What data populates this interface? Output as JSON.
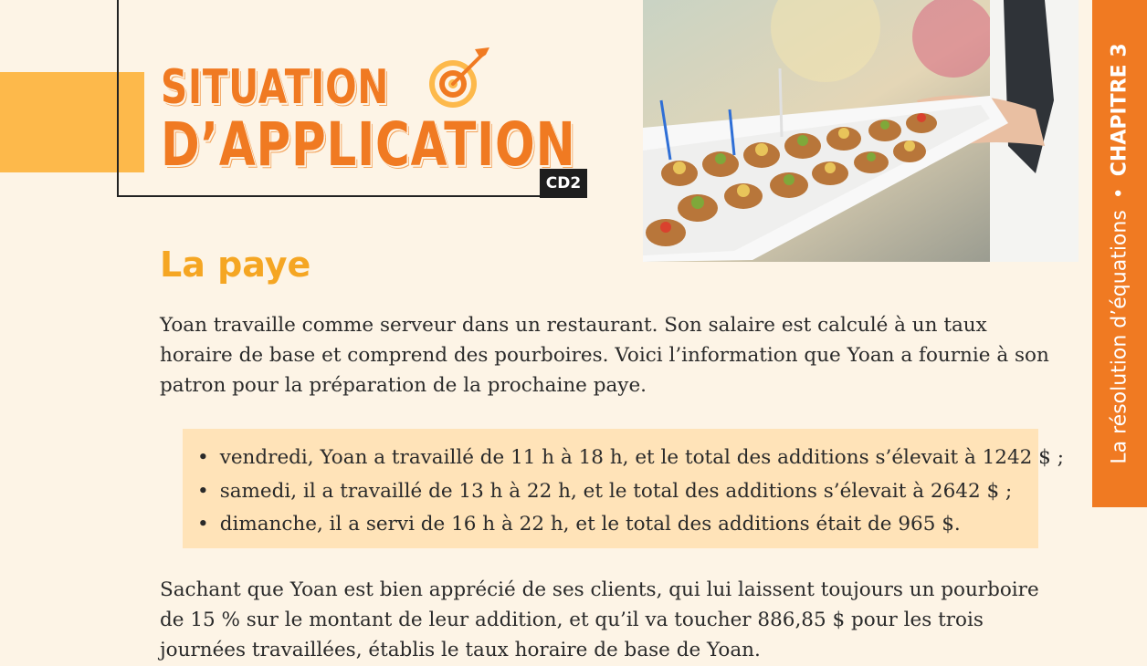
{
  "header": {
    "title_line1": "SITUATION",
    "title_line2": "D’APPLICATION",
    "badge": "CD2",
    "icon": "target-icon",
    "photo": "waiter-serving-appetizers-photo"
  },
  "side_tab": {
    "chapter": "CHAPITRE 3",
    "separator": "•",
    "topic": "La résolution d’équations"
  },
  "section": {
    "title": "La paye",
    "intro": "Yoan travaille comme serveur dans un restaurant. Son salaire est calculé à un taux horaire de base et comprend des pourboires. Voici l’information que Yoan a fournie à son patron pour la préparation de la prochaine paye.",
    "items": [
      "vendredi, Yoan a travaillé de 11 h à 18 h, et le total des additions s’élevait à 1242 $ ;",
      "samedi, il a travaillé de 13 h à 22 h, et le total des additions s’élevait à 2642 $ ;",
      "dimanche, il a servi de 16 h à 22 h, et le total des additions était de 965 $."
    ],
    "question": "Sachant que Yoan est bien apprécié de ses clients, qui lui laissent toujours un pourboire de 15 % sur le montant de leur addition, et qu’il va toucher 886,85 $ pour les trois journées travaillées, établis le taux horaire de base de Yoan."
  },
  "colors": {
    "accent_orange": "#f07a22",
    "accent_yellow": "#fdb94b",
    "subtitle": "#f5a623",
    "box_background": "#ffe3b8",
    "page_background": "#fdf4e6"
  }
}
